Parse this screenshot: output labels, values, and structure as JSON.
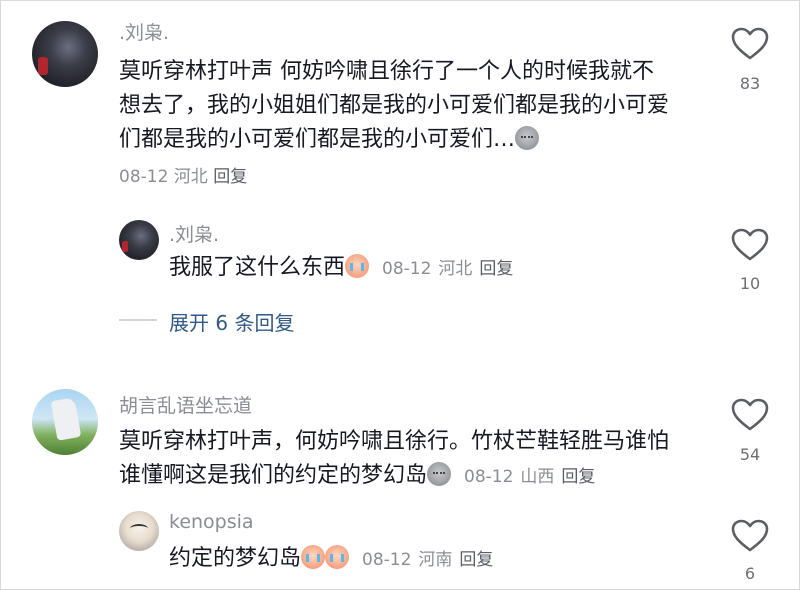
{
  "comments": [
    {
      "username": ".刘枭.",
      "text_line1": "莫听穿林打叶声 何妨吟啸且徐行了一个人的时候我就不",
      "text_line2": "想去了，我的小姐姐们都是我的小可爱们都是我的小可爱",
      "text_line3": "们都是我的小可爱们都是我的小可爱们…",
      "date": "08-12",
      "location": "河北",
      "reply_label": "回复",
      "likes": "83",
      "replies": [
        {
          "username": ".刘枭.",
          "text": "我服了这什么东西",
          "date": "08-12",
          "location": "河北",
          "reply_label": "回复",
          "likes": "10"
        }
      ],
      "expand_label": "展开 6 条回复"
    },
    {
      "username": "胡言乱语坐忘道",
      "text_line1": "莫听穿林打叶声，何妨吟啸且徐行。竹杖芒鞋轻胜马谁怕",
      "text_line2": "谁懂啊这是我们的约定的梦幻岛",
      "date": "08-12",
      "location": "山西",
      "reply_label": "回复",
      "likes": "54",
      "replies": [
        {
          "username": "kenopsia",
          "text": "约定的梦幻岛",
          "date": "08-12",
          "location": "河南",
          "reply_label": "回复",
          "likes": "6"
        }
      ]
    }
  ],
  "icons": {
    "heart": "heart-outline-icon",
    "emoji_sweat": "sweat-face-emoji",
    "emoji_cry": "crying-face-emoji"
  },
  "colors": {
    "text": "#161823",
    "meta": "#8a8d93",
    "expand": "#2f5a88"
  }
}
